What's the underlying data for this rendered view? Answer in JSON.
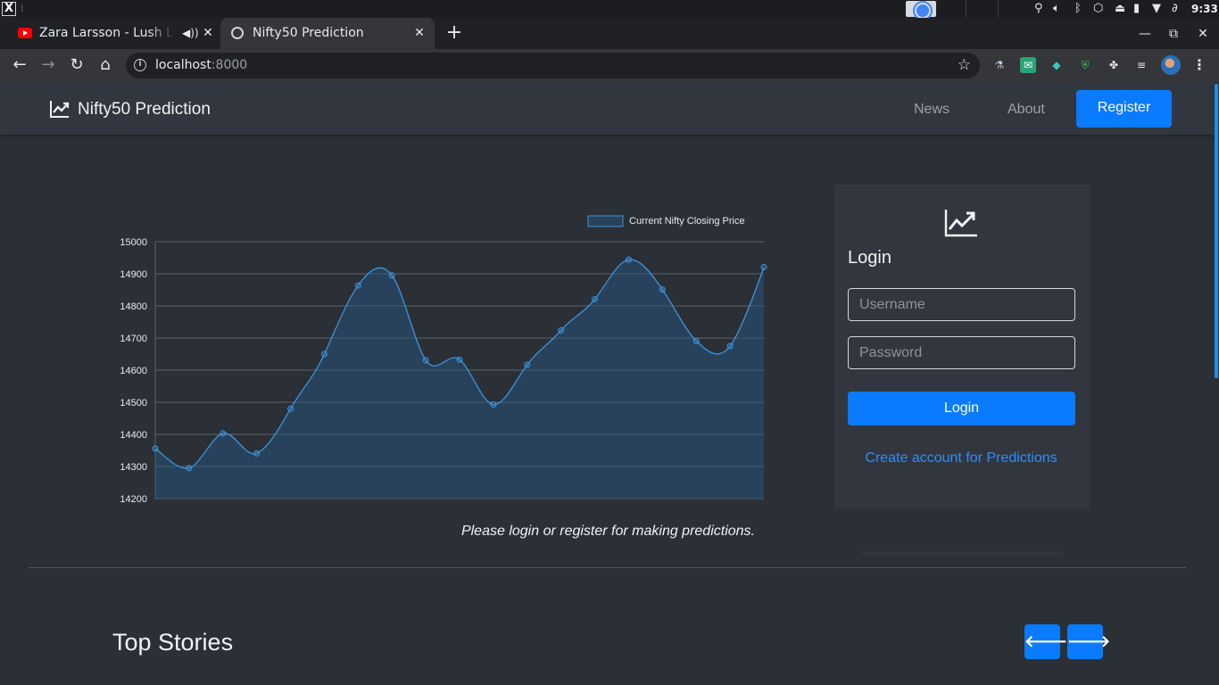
{
  "os": {
    "clock": "9:33",
    "tray_icons": [
      "location-icon",
      "volume-icon",
      "bluetooth-icon",
      "package-icon",
      "upload-icon",
      "battery-icon",
      "wifi-icon",
      "attachment-icon"
    ]
  },
  "browser": {
    "tabs": [
      {
        "title": "Zara Larsson - Lush Life",
        "favicon": "youtube-icon",
        "audio": true,
        "active": false
      },
      {
        "title": "Nifty50 Prediction",
        "favicon": "globe-icon",
        "active": true
      }
    ],
    "url_host": "localhost",
    "url_port": ":8000",
    "extensions": [
      "extension-1-icon",
      "mail-extension-icon",
      "extension-3-icon",
      "shield-extension-icon",
      "puzzle-icon",
      "media-control-icon"
    ]
  },
  "site": {
    "brand": "Nifty50 Prediction",
    "nav": {
      "news": "News",
      "about": "About",
      "register": "Register"
    }
  },
  "login": {
    "title": "Login",
    "username_placeholder": "Username",
    "password_placeholder": "Password",
    "button": "Login",
    "create_link": "Create account for Predictions"
  },
  "chart_note": "Please login or register for making predictions.",
  "top_stories": {
    "title": "Top Stories",
    "prev_icon": "arrow-left-icon",
    "next_icon": "arrow-right-icon"
  },
  "colors": {
    "accent": "#0a7bff",
    "link": "#2f8ef5",
    "line": "#3b95db",
    "page_bg": "#2b2f36",
    "nav_bg": "#32363e"
  },
  "chart_data": {
    "type": "line",
    "series": [
      {
        "name": "Current Nifty Closing Price",
        "values": [
          14356,
          14295,
          14403,
          14341,
          14480,
          14650,
          14864,
          14895,
          14631,
          14633,
          14493,
          14617,
          14724,
          14821,
          14944,
          14851,
          14691,
          14675,
          14921
        ]
      }
    ],
    "ylim": [
      14200,
      15000
    ],
    "yticks": [
      15000,
      14900,
      14800,
      14700,
      14600,
      14500,
      14400,
      14300,
      14200
    ],
    "legend": "top-right",
    "grid": true,
    "fill": true,
    "curve": "smooth"
  }
}
